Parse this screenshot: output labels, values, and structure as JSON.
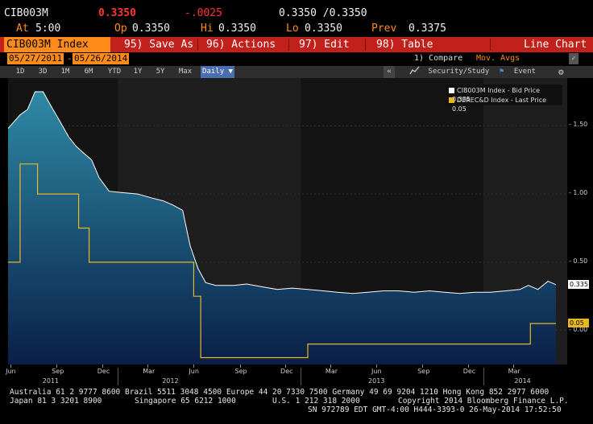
{
  "header": {
    "ticker": "CIB003M",
    "last_price": "0.3350",
    "change": "-.0025",
    "bid_ask": "0.3350 /0.3350",
    "time_label": "At",
    "time": "5:00",
    "open_label": "Op",
    "open": "0.3350",
    "high_label": "Hi",
    "high": "0.3350",
    "low_label": "Lo",
    "low": "0.3350",
    "prev_label": "Prev",
    "prev": "0.3375"
  },
  "menu": {
    "security": "CIB003M Index",
    "save": "95) Save As",
    "actions": "96) Actions",
    "edit": "97) Edit",
    "table": "98) Table",
    "view": "Line Chart"
  },
  "dates": {
    "start": "05/27/2011",
    "sep": "-",
    "end": "05/26/2014",
    "compare": "1) Compare",
    "mov_avgs": "Mov. Avgs"
  },
  "periods": [
    "1D",
    "3D",
    "1M",
    "6M",
    "YTD",
    "1Y",
    "5Y",
    "Max"
  ],
  "frequency": "Daily ▼",
  "toolbar": {
    "collapse": "«",
    "security_study": "Security/Study",
    "event": "Event"
  },
  "legend": [
    {
      "label": "CIB003M Index - Bid Price",
      "value": "0.335",
      "color": "#ffffff"
    },
    {
      "label": "DEREC&D Index - Last Price",
      "value": "0.05",
      "color": "#e8b820"
    }
  ],
  "chart_data": {
    "type": "area",
    "ylim": [
      -0.25,
      1.85
    ],
    "yticks": [
      "1.50",
      "1.00",
      "0.50",
      "0.00"
    ],
    "x_month_labels": [
      "Jun",
      "Sep",
      "Dec",
      "Mar",
      "Jun",
      "Sep",
      "Dec",
      "Mar",
      "Jun",
      "Sep",
      "Dec",
      "Mar"
    ],
    "x_year_labels": [
      "2011",
      "2012",
      "2013",
      "2014"
    ],
    "series": [
      {
        "name": "CIB003M Index - Bid Price",
        "color": "#ffffff",
        "fill_top": "#2e8aa5",
        "fill_bottom": "#0a1f48",
        "last_value": "0.335",
        "x": [
          "2011-05-27",
          "2011-06-20",
          "2011-07-05",
          "2011-07-20",
          "2011-08-05",
          "2011-08-20",
          "2011-09-05",
          "2011-09-25",
          "2011-10-10",
          "2011-10-25",
          "2011-11-10",
          "2011-11-25",
          "2011-12-15",
          "2012-01-10",
          "2012-02-10",
          "2012-03-10",
          "2012-04-01",
          "2012-04-20",
          "2012-05-10",
          "2012-05-25",
          "2012-06-10",
          "2012-06-25",
          "2012-07-15",
          "2012-08-01",
          "2012-08-20",
          "2012-09-15",
          "2012-10-15",
          "2012-11-15",
          "2012-12-15",
          "2013-01-15",
          "2013-02-15",
          "2013-03-15",
          "2013-04-15",
          "2013-05-15",
          "2013-06-15",
          "2013-07-15",
          "2013-08-15",
          "2013-09-15",
          "2013-10-15",
          "2013-11-15",
          "2013-12-15",
          "2014-01-15",
          "2014-02-15",
          "2014-03-15",
          "2014-04-01",
          "2014-04-20",
          "2014-05-10",
          "2014-05-26"
        ],
        "y": [
          1.48,
          1.58,
          1.62,
          1.75,
          1.75,
          1.65,
          1.55,
          1.42,
          1.35,
          1.3,
          1.25,
          1.12,
          1.02,
          1.01,
          1.0,
          0.97,
          0.95,
          0.92,
          0.88,
          0.62,
          0.45,
          0.35,
          0.33,
          0.33,
          0.33,
          0.34,
          0.32,
          0.3,
          0.31,
          0.3,
          0.29,
          0.28,
          0.27,
          0.28,
          0.29,
          0.29,
          0.28,
          0.29,
          0.28,
          0.27,
          0.28,
          0.28,
          0.29,
          0.3,
          0.33,
          0.3,
          0.36,
          0.335
        ]
      },
      {
        "name": "DEREC&D Index - Last Price",
        "color": "#e8b820",
        "last_value": "0.05",
        "step": true,
        "x": [
          "2011-05-27",
          "2011-06-20",
          "2011-07-10",
          "2011-07-25",
          "2011-10-15",
          "2011-11-05",
          "2012-06-01",
          "2012-06-15",
          "2013-01-15",
          "2014-04-05",
          "2014-05-26"
        ],
        "y": [
          0.5,
          1.22,
          1.22,
          1.0,
          0.75,
          0.5,
          0.25,
          -0.2,
          -0.1,
          0.05,
          0.05
        ]
      }
    ]
  },
  "footer": {
    "line1": "Australia 61 2 9777 8600 Brazil 5511 3048 4500 Europe 44 20 7330 7500 Germany 49 69 9204 1210 Hong Kong 852 2977 6000",
    "line2a": "Japan 81 3 3201 8900",
    "line2b": "Singapore 65 6212 1000",
    "line2c": "U.S. 1 212 318 2000",
    "line2d": "Copyright 2014 Bloomberg Finance L.P.",
    "line3": "SN 972789 EDT  GMT-4:00 H444-3393-0 26-May-2014 17:52:50"
  }
}
